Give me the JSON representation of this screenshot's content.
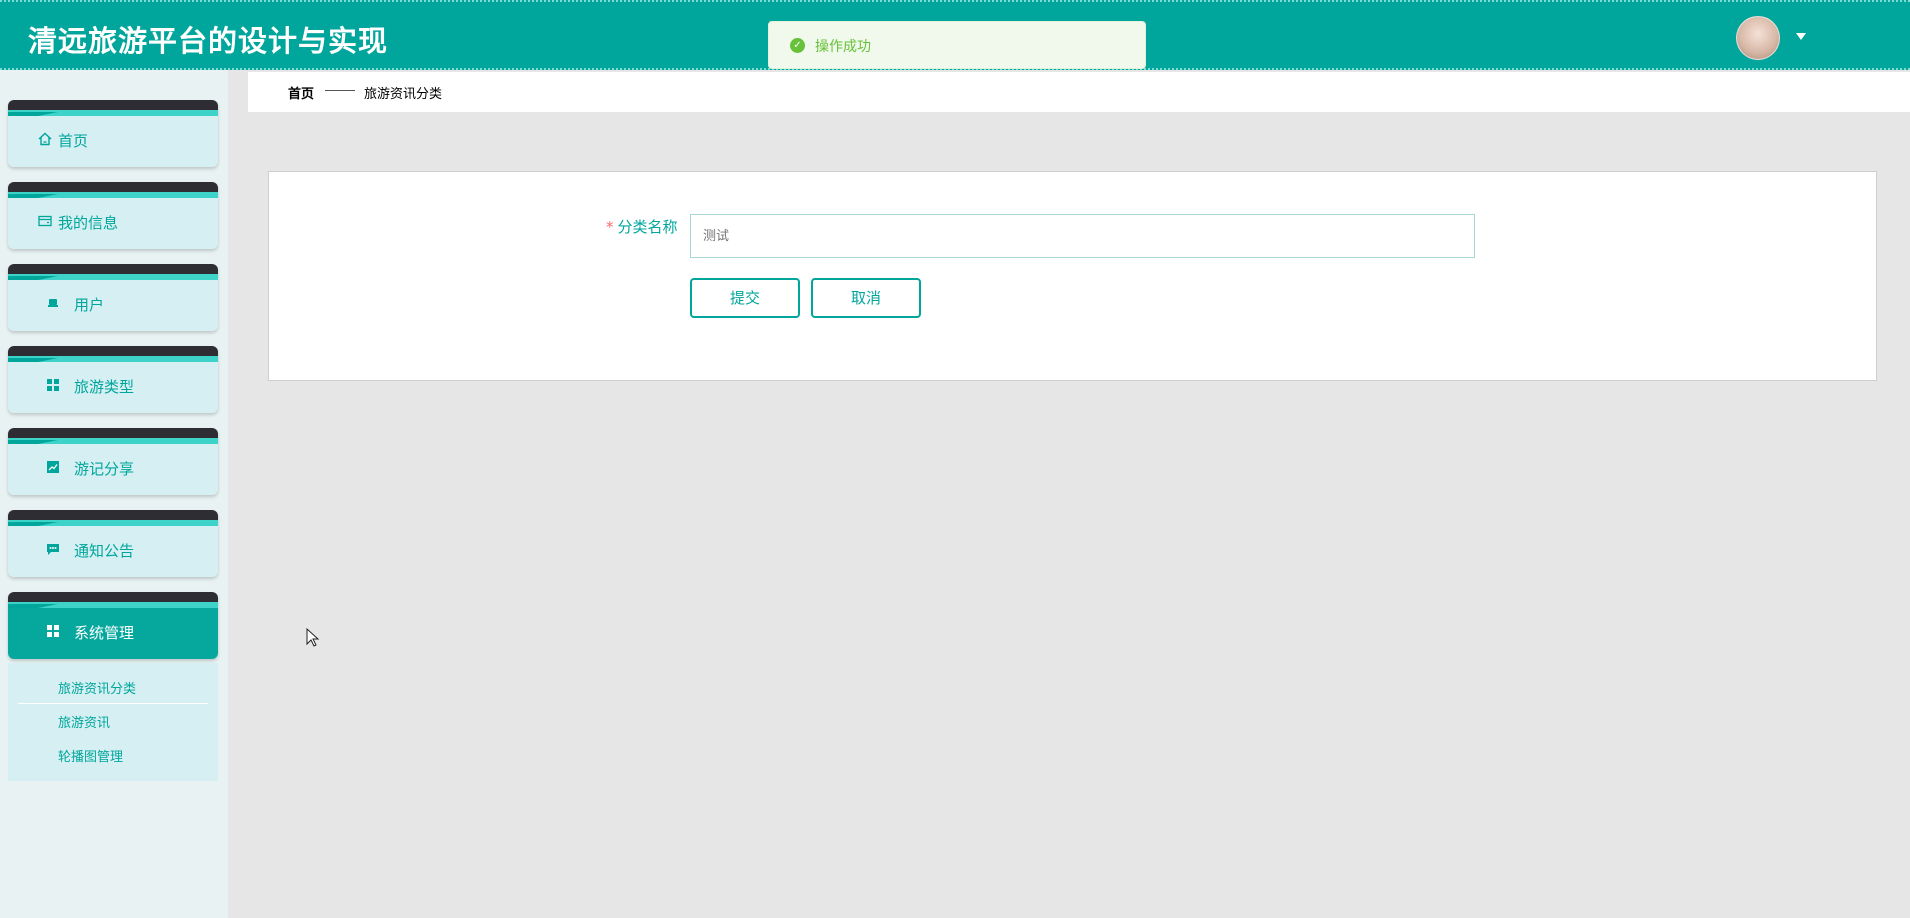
{
  "header": {
    "title": "清远旅游平台的设计与实现",
    "toast_text": "操作成功",
    "toast_icon": "check-circle-icon"
  },
  "sidebar": {
    "items": [
      {
        "label": "首页",
        "icon": "home-icon"
      },
      {
        "label": "我的信息",
        "icon": "card-icon"
      },
      {
        "label": "用户",
        "icon": "seat-icon"
      },
      {
        "label": "旅游类型",
        "icon": "grid-icon"
      },
      {
        "label": "游记分享",
        "icon": "chart-icon"
      },
      {
        "label": "通知公告",
        "icon": "message-icon"
      },
      {
        "label": "系统管理",
        "icon": "grid-icon"
      }
    ],
    "submenu": [
      "旅游资讯分类",
      "旅游资讯",
      "轮播图管理"
    ]
  },
  "breadcrumb": {
    "home": "首页",
    "current": "旅游资讯分类"
  },
  "form": {
    "required_mark": "*",
    "label": "分类名称",
    "placeholder": "测试",
    "submit_label": "提交",
    "cancel_label": "取消"
  },
  "colors": {
    "accent": "#00a69c",
    "header_bg": "#00a69c",
    "success": "#67c23a",
    "required": "#f56c6c"
  }
}
